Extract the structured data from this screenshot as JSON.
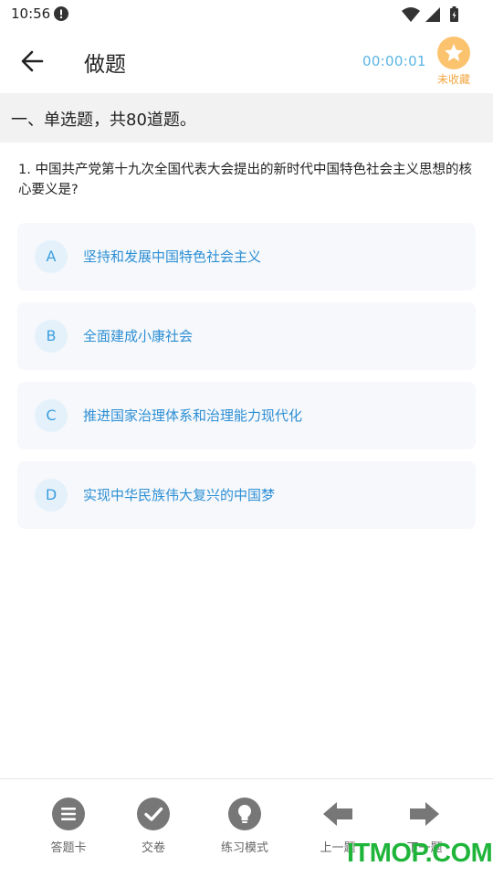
{
  "status_bar": {
    "time": "10:56"
  },
  "header": {
    "title": "做题",
    "timer": "00:00:01",
    "favorite_label": "未收藏"
  },
  "section": {
    "title": "一、单选题，共80道题。"
  },
  "question": {
    "text": "1. 中国共产党第十九次全国代表大会提出的新时代中国特色社会主义思想的核心要义是?"
  },
  "options": [
    {
      "letter": "A",
      "text": "坚持和发展中国特色社会主义"
    },
    {
      "letter": "B",
      "text": "全面建成小康社会"
    },
    {
      "letter": "C",
      "text": "推进国家治理体系和治理能力现代化"
    },
    {
      "letter": "D",
      "text": "实现中华民族伟大复兴的中国梦"
    }
  ],
  "bottom_bar": {
    "items": [
      {
        "label": "答题卡",
        "icon": "list-icon"
      },
      {
        "label": "交卷",
        "icon": "check-icon"
      },
      {
        "label": "练习模式",
        "icon": "bulb-icon"
      },
      {
        "label": "上一题",
        "icon": "arrow-left-icon"
      },
      {
        "label": "下一题",
        "icon": "arrow-right-icon"
      }
    ]
  },
  "watermark": "ITMOP.COM",
  "colors": {
    "accent": "#2d8fd5",
    "timer": "#5ab4e6",
    "favorite": "#fbc36e",
    "icon_gray": "#777777"
  }
}
